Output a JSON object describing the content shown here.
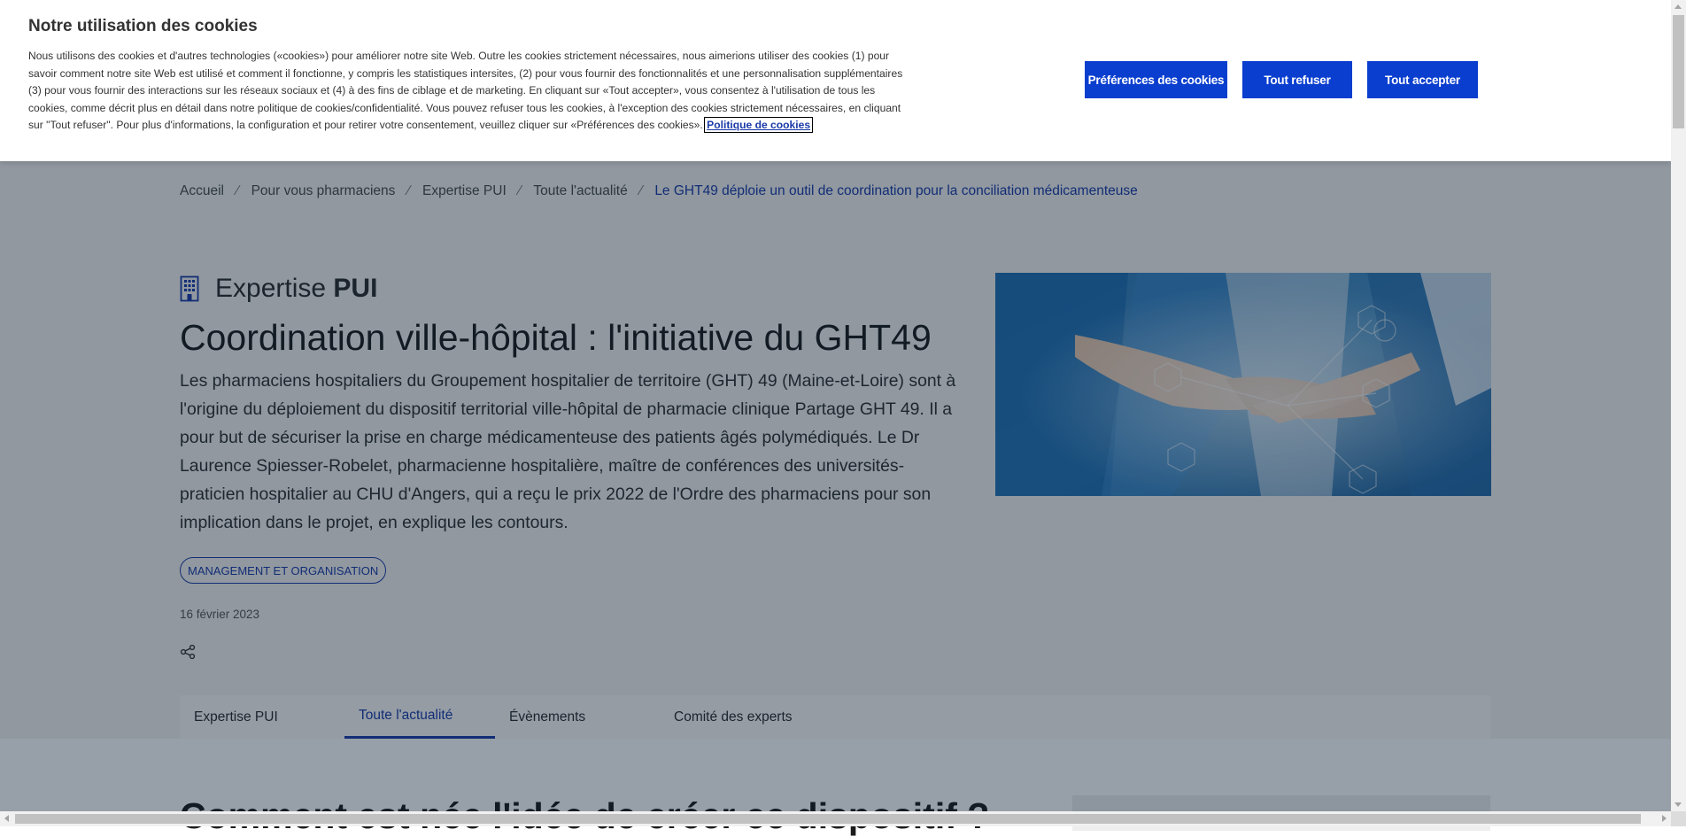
{
  "cookie_banner": {
    "title": "Notre utilisation des cookies",
    "text": "Nous utilisons des cookies et d'autres technologies («cookies») pour améliorer notre site Web. Outre les cookies strictement nécessaires, nous aimerions utiliser des cookies (1) pour savoir comment notre site Web est utilisé et comment il fonctionne, y compris les statistiques intersites, (2) pour vous fournir des fonctionnalités et une personnalisation supplémentaires (3) pour vous fournir des interactions sur les réseaux sociaux et (4) à des fins de ciblage et de marketing. En cliquant sur «Tout accepter», vous consentez à l'utilisation de tous les cookies, comme décrit plus en détail dans notre politique de cookies/confidentialité. Vous pouvez refuser tous les cookies, à l'exception des cookies strictement nécessaires, en cliquant sur \"Tout refuser\". Pour plus d'informations, la configuration et pour retirer votre consentement, veuillez cliquer sur «Préférences des cookies».",
    "policy_link": "Politique de cookies",
    "buttons": {
      "preferences": "Préférences des cookies",
      "refuse": "Tout refuser",
      "accept": "Tout accepter"
    },
    "accent_color": "#0a3ecf"
  },
  "breadcrumb": {
    "items": [
      "Accueil",
      "Pour vous pharmaciens",
      "Expertise PUI",
      "Toute l'actualité"
    ],
    "current": "Le GHT49 déploie un outil de coordination pour la conciliation médicamenteuse",
    "separator": "⁄"
  },
  "article": {
    "section_prefix": "Expertise ",
    "section_bold": "PUI",
    "section_icon": "building-icon",
    "title": "Coordination ville-hôpital : l'initiative du GHT49",
    "intro": "Les pharmaciens hospitaliers du Groupement hospitalier de territoire (GHT) 49 (Maine-et-Loire) sont à l'origine du déploiement du dispositif territorial ville-hôpital de pharmacie clinique Partage GHT 49. Il a pour but de sécuriser la prise en charge médicamenteuse des patients âgés polymédiqués. Le Dr Laurence Spiesser-Robelet, pharmacienne hospitalière, maître de conférences des universités-praticien hospitalier au CHU d'Angers, qui a reçu le prix 2022 de l'Ordre des pharmaciens pour son implication dans le projet, en explique les contours.",
    "tag": "MANAGEMENT ET ORGANISATION",
    "date": "16 février 2023",
    "share_icon": "share-icon",
    "next_heading": "Comment est née l'idée de créer ce dispositif ?"
  },
  "tabs": [
    {
      "label": "Expertise PUI",
      "active": false
    },
    {
      "label": "Toute l'actualité",
      "active": true
    },
    {
      "label": "Évènements",
      "active": false
    },
    {
      "label": "Comité des experts",
      "active": false
    }
  ],
  "colors": {
    "brand_blue": "#1a3aa8",
    "hero_bg": "#f4f2ee"
  }
}
